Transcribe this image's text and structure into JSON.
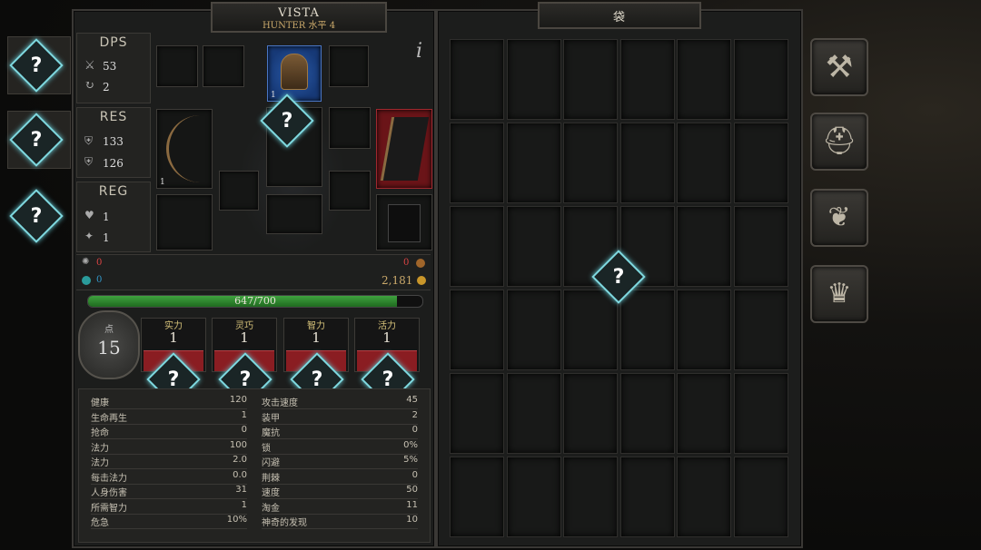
{
  "character": {
    "name": "VISTA",
    "class_level": "HUNTER 水平 4"
  },
  "bag": {
    "title": "袋"
  },
  "summary": {
    "dps_label": "DPS",
    "dps_attack": "53",
    "dps_speed": "2",
    "res_label": "RES",
    "res_armor": "133",
    "res_magic": "126",
    "reg_label": "REG",
    "reg_health": "1",
    "reg_mana": "1"
  },
  "info_icon": "i",
  "equip": {
    "helmet_level": "1",
    "bow_level": "1"
  },
  "status_row": {
    "left1": "0",
    "left2": "0",
    "right1": "0",
    "gold": "2,181"
  },
  "health_bar": {
    "text": "647/700",
    "fraction": 0.924
  },
  "points": {
    "label": "点",
    "value": "15"
  },
  "attributes": [
    {
      "label": "实力",
      "value": "1"
    },
    {
      "label": "灵巧",
      "value": "1"
    },
    {
      "label": "智力",
      "value": "1"
    },
    {
      "label": "活力",
      "value": "1"
    }
  ],
  "stats_left": [
    {
      "k": "健康",
      "v": "120"
    },
    {
      "k": "生命再生",
      "v": "1"
    },
    {
      "k": "抢命",
      "v": "0"
    },
    {
      "k": "法力",
      "v": "100"
    },
    {
      "k": "法力",
      "v": "2.0"
    },
    {
      "k": "每击法力",
      "v": "0.0"
    },
    {
      "k": "人身伤害",
      "v": "31"
    },
    {
      "k": "所需智力",
      "v": "1"
    },
    {
      "k": "危急",
      "v": "10%"
    }
  ],
  "stats_right": [
    {
      "k": "攻击速度",
      "v": "45"
    },
    {
      "k": "装甲",
      "v": "2"
    },
    {
      "k": "魔抗",
      "v": "0"
    },
    {
      "k": "锁",
      "v": "0%"
    },
    {
      "k": "闪避",
      "v": "5%"
    },
    {
      "k": "荆棘",
      "v": "0"
    },
    {
      "k": "速度",
      "v": "50"
    },
    {
      "k": "淘金",
      "v": "11"
    },
    {
      "k": "神奇的发现",
      "v": "10"
    }
  ],
  "hint_mark": "?",
  "side_buttons": [
    "axe-icon",
    "helmet-icon",
    "wings-icon",
    "crown-icon"
  ],
  "colors": {
    "health": "#2f8a2f",
    "attribute_bar": "#8a1d22",
    "hint_glow": "#7fd9e0",
    "gold_text": "#c9a86a"
  }
}
